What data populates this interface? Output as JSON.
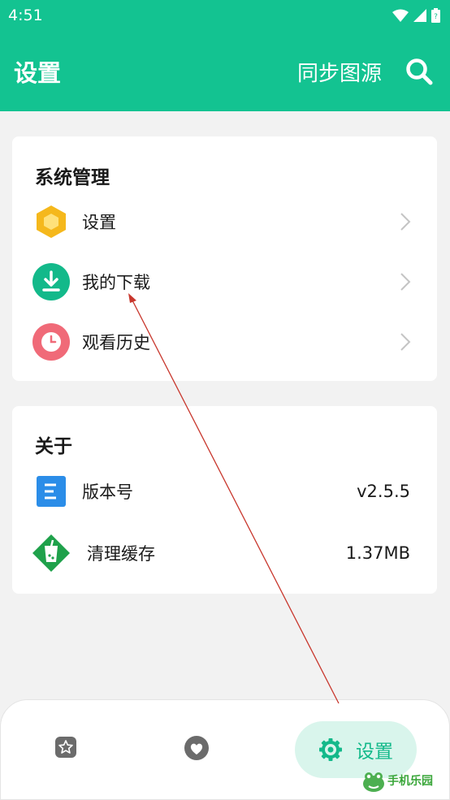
{
  "status_bar": {
    "time": "4:51"
  },
  "header": {
    "title": "设置",
    "sync_label": "同步图源"
  },
  "system_section": {
    "title": "系统管理",
    "items": [
      {
        "label": "设置",
        "icon": "hexagon-icon"
      },
      {
        "label": "我的下载",
        "icon": "download-icon"
      },
      {
        "label": "观看历史",
        "icon": "clock-icon"
      }
    ]
  },
  "about_section": {
    "title": "关于",
    "items": [
      {
        "label": "版本号",
        "value": "v2.5.5",
        "icon": "document-icon"
      },
      {
        "label": "清理缓存",
        "value": "1.37MB",
        "icon": "cup-icon"
      }
    ]
  },
  "bottom_nav": {
    "settings_label": "设置"
  },
  "watermark": {
    "text": "手机乐园"
  },
  "colors": {
    "primary": "#13c391",
    "nav_active_bg": "#d9f5ec",
    "annotation": "#c8372d"
  }
}
